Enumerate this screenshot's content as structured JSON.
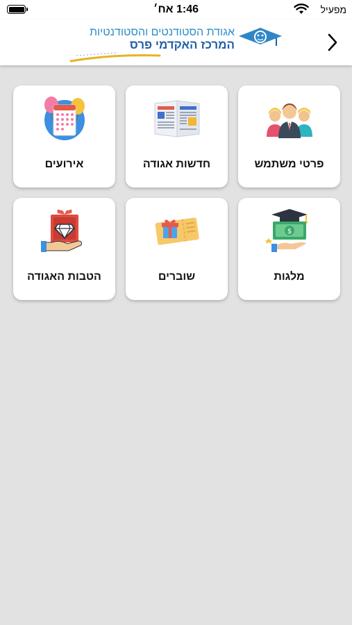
{
  "status_bar": {
    "time": "1:46 אח׳",
    "carrier": "מפעיל"
  },
  "header": {
    "logo_line1": "אגודת הסטודנטים והסטודנטיות",
    "logo_line2": "המרכז האקדמי פרס"
  },
  "tiles": [
    {
      "label": "פרטי משתמש",
      "icon": "people-icon"
    },
    {
      "label": "חדשות אגודה",
      "icon": "newspaper-icon"
    },
    {
      "label": "אירועים",
      "icon": "calendar-balloons-icon"
    },
    {
      "label": "מלגות",
      "icon": "scholarship-money-icon"
    },
    {
      "label": "שוברים",
      "icon": "voucher-ticket-icon"
    },
    {
      "label": "הטבות האגודה",
      "icon": "gift-diamond-icon"
    }
  ],
  "colors": {
    "background": "#e2e2e2",
    "tile": "#ffffff",
    "logo_blue_light": "#2b8fc9",
    "logo_blue_dark": "#1f5ea8",
    "accent_gold": "#e6b422"
  }
}
